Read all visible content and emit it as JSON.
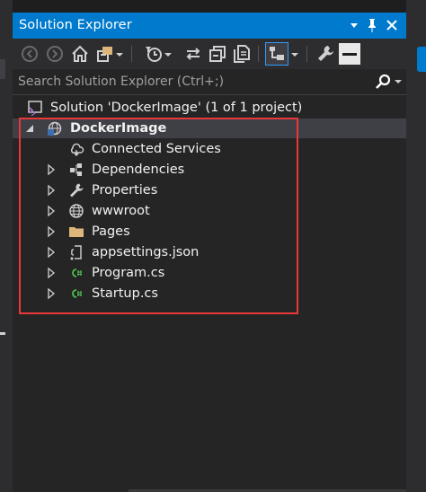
{
  "window": {
    "title": "Solution Explorer",
    "accent_color": "#007acc",
    "highlight_color": "#e8383a"
  },
  "titlebar_buttons": [
    {
      "name": "dropdown-arrow-icon",
      "glyph": "▾"
    },
    {
      "name": "pin-icon",
      "glyph": "📌"
    },
    {
      "name": "close-icon",
      "glyph": "✕"
    }
  ],
  "toolbar": {
    "icons": [
      "back-icon",
      "forward-icon",
      "home-icon",
      "switch-views-icon",
      "pending-changes-filter-icon",
      "sync-active-document-icon",
      "collapse-all-icon",
      "show-all-files-icon",
      "preview-selected-items-icon",
      "properties-icon",
      "dock-toggle-icon"
    ]
  },
  "search": {
    "placeholder": "Search Solution Explorer (Ctrl+;)"
  },
  "tree": {
    "solution_label": "Solution 'DockerImage' (1 of 1 project)",
    "project_label": "DockerImage",
    "items": [
      {
        "label": "Connected Services",
        "icon": "connected-services-icon",
        "expandable": false
      },
      {
        "label": "Dependencies",
        "icon": "dependencies-icon",
        "expandable": true
      },
      {
        "label": "Properties",
        "icon": "wrench-icon",
        "expandable": true
      },
      {
        "label": "wwwroot",
        "icon": "globe-icon",
        "expandable": true
      },
      {
        "label": "Pages",
        "icon": "folder-icon",
        "expandable": true
      },
      {
        "label": "appsettings.json",
        "icon": "json-file-icon",
        "expandable": true
      },
      {
        "label": "Program.cs",
        "icon": "csharp-file-icon",
        "expandable": true
      },
      {
        "label": "Startup.cs",
        "icon": "csharp-file-icon",
        "expandable": true
      }
    ]
  }
}
